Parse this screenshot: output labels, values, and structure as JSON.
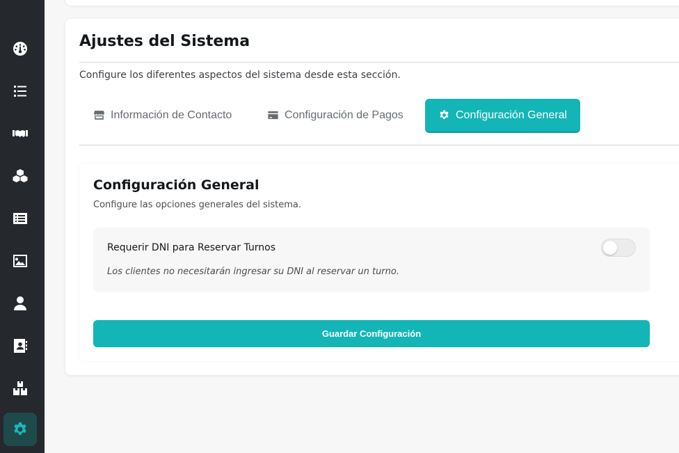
{
  "sidebar": {
    "items": [
      {
        "icon": "dashboard-icon",
        "active": false
      },
      {
        "icon": "list-icon",
        "active": false
      },
      {
        "icon": "handshake-icon",
        "active": false
      },
      {
        "icon": "cubes-icon",
        "active": false
      },
      {
        "icon": "receipt-list-icon",
        "active": false
      },
      {
        "icon": "image-icon",
        "active": false
      },
      {
        "icon": "user-icon",
        "active": false
      },
      {
        "icon": "address-book-icon",
        "active": false
      },
      {
        "icon": "boxes-icon",
        "active": false
      },
      {
        "icon": "gear-icon",
        "active": true
      }
    ],
    "active_color": "#1cb8b9"
  },
  "page": {
    "title": "Ajustes del Sistema",
    "subtitle": "Configure los diferentes aspectos del sistema desde esta sección."
  },
  "tabs": [
    {
      "label": "Información de Contacto",
      "icon": "store-icon",
      "active": false
    },
    {
      "label": "Configuración de Pagos",
      "icon": "credit-card-icon",
      "active": false
    },
    {
      "label": "Configuración General",
      "icon": "gear-icon",
      "active": true
    }
  ],
  "general": {
    "title": "Configuración General",
    "subtitle": "Configure las opciones generales del sistema.",
    "setting": {
      "label": "Requerir DNI para Reservar Turnos",
      "help": "Los clientes no necesitarán ingresar su DNI al reservar un turno.",
      "enabled": false
    },
    "save_label": "Guardar Configuración"
  },
  "colors": {
    "accent": "#13b5b7",
    "sidebar_bg": "#25282d",
    "page_bg": "#f7f7f7"
  }
}
